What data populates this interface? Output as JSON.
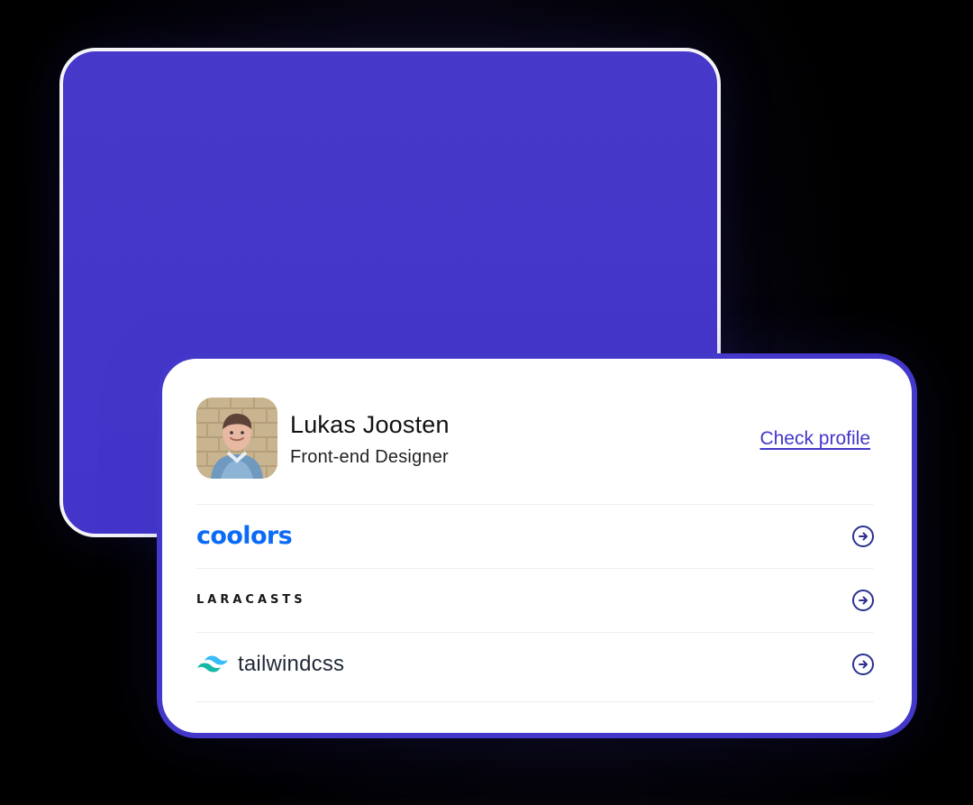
{
  "profile": {
    "name": "Lukas Joosten",
    "role": "Front-end Designer",
    "link_label": "Check profile",
    "avatar_icon": "profile-photo"
  },
  "companies": [
    {
      "label": "coolors",
      "logo_icon": "coolors-logo",
      "action_icon": "arrow-right-circle-icon",
      "brand_color": "#0C6BF5"
    },
    {
      "label": "LARACASTS",
      "logo_icon": "laracasts-logo",
      "action_icon": "arrow-right-circle-icon",
      "brand_color": "#171717"
    },
    {
      "label": "tailwindcss",
      "logo_icon": "tailwind-wave-logo",
      "action_icon": "arrow-right-circle-icon",
      "brand_color": "#38BDF8"
    }
  ],
  "colors": {
    "primary": "#4338CA",
    "back_card": "#4336CA",
    "card_background": "#FFFFFF",
    "text": "#111111",
    "divider": "#EEEEEE"
  }
}
